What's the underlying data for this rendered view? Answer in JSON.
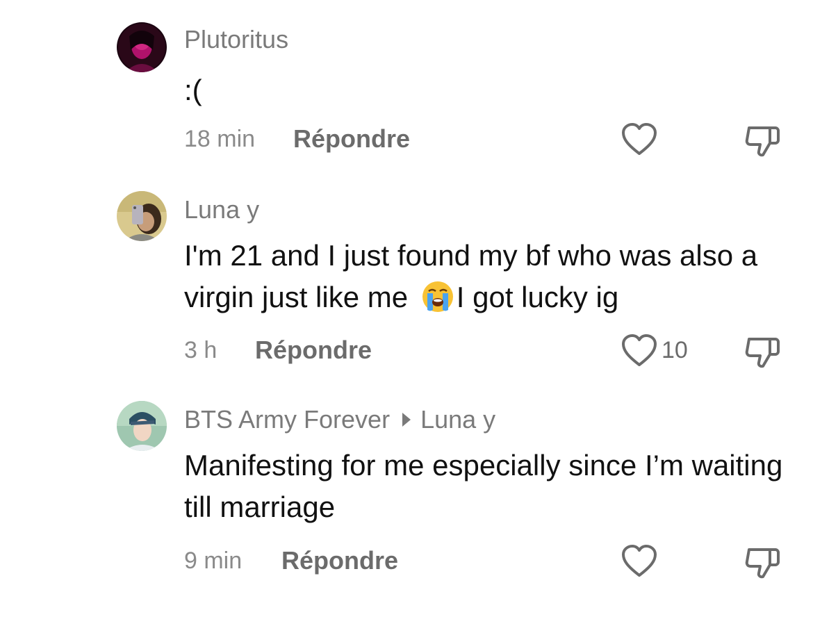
{
  "comments": [
    {
      "username": "Plutoritus",
      "text": ":(",
      "time": "18 min",
      "reply_label": "Répondre",
      "like_count": "",
      "avatar_icon": "avatar-plutoritus"
    },
    {
      "username": "Luna y",
      "text_before_emoji": "I'm 21 and I just found my bf who was also a virgin just like me ",
      "emoji": "loudly-crying-face",
      "text_after_emoji": "I got lucky ig",
      "time": "3 h",
      "reply_label": "Répondre",
      "like_count": "10",
      "avatar_icon": "avatar-luna"
    },
    {
      "username": "BTS Army Forever",
      "reply_to": "Luna y",
      "text": "Manifesting for me especially since I’m waiting till marriage",
      "time": "9 min",
      "reply_label": "Répondre",
      "like_count": "",
      "avatar_icon": "avatar-bts-army"
    }
  ],
  "icons": {
    "like": "heart-outline-icon",
    "dislike": "thumbs-down-outline-icon"
  },
  "colors": {
    "username": "#7a7a7a",
    "text": "#111111",
    "meta": "#8a8a8a",
    "icon": "#6b6b6b"
  }
}
